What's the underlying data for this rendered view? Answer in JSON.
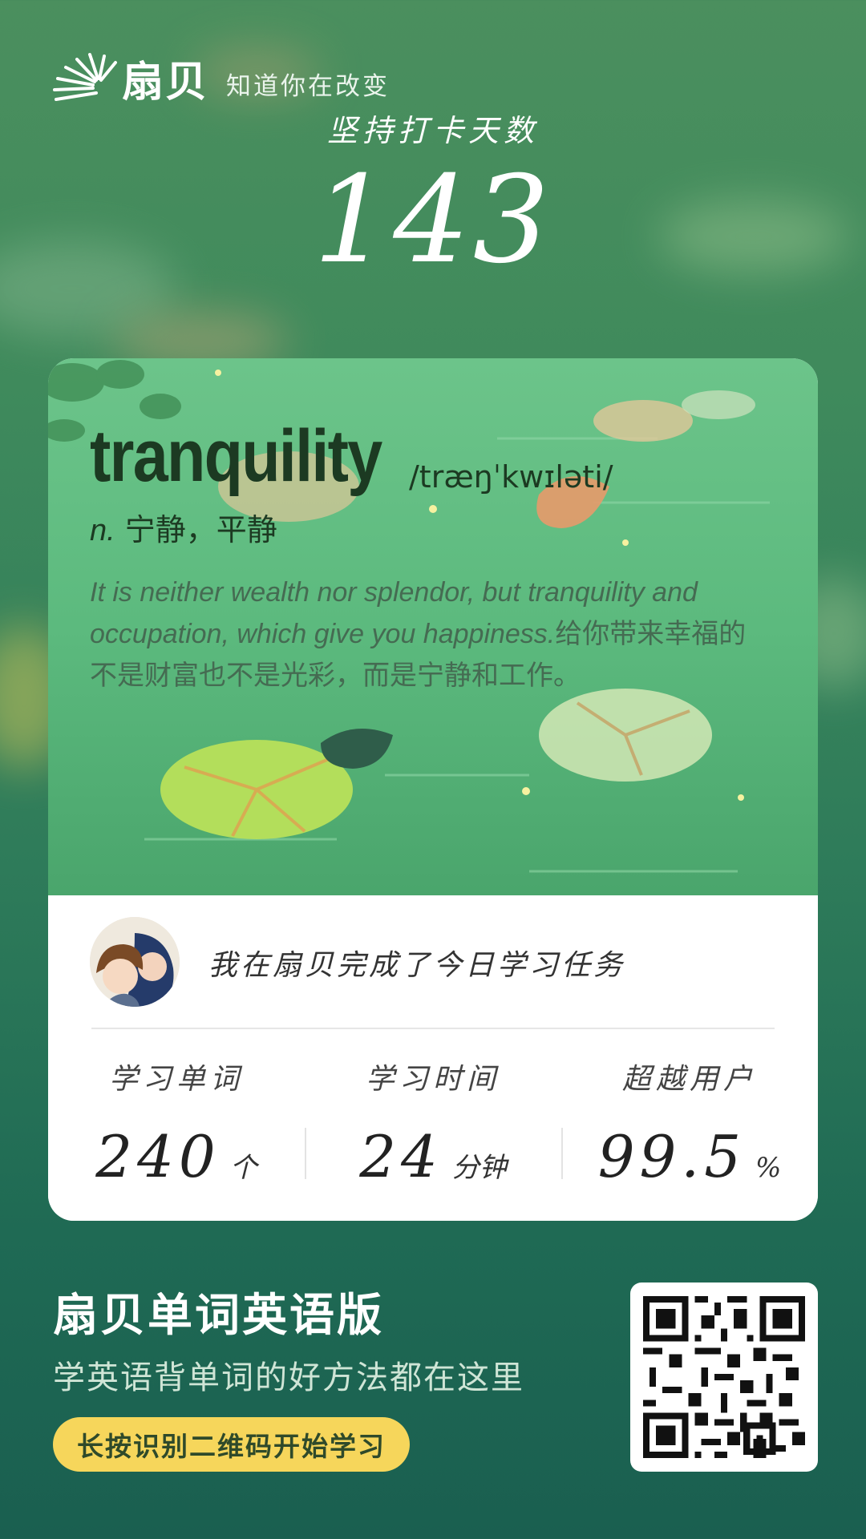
{
  "header": {
    "brand_name": "扇贝",
    "slogan": "知道你在改变",
    "streak_label": "坚持打卡天数",
    "streak_days": "143"
  },
  "word_card": {
    "word": "tranquility",
    "phonetic": "/træŋˈkwɪləti/",
    "part_of_speech": "n.",
    "definition": "宁静，平静",
    "example_en": "It is neither wealth nor splendor, but tranquility and occupation, which give you happiness.",
    "example_zh": "给你带来幸福的不是财富也不是光彩，而是宁静和工作。"
  },
  "summary": {
    "done_text": "我在扇贝完成了今日学习任务",
    "stats": [
      {
        "label": "学习单词",
        "value": "240",
        "unit": "个"
      },
      {
        "label": "学习时间",
        "value": "24",
        "unit": "分钟"
      },
      {
        "label": "超越用户",
        "value": "99.5",
        "unit": "%"
      }
    ]
  },
  "footer": {
    "app_title": "扇贝单词英语版",
    "app_subtitle": "学英语背单词的好方法都在这里",
    "cta_label": "长按识别二维码开始学习"
  },
  "icons": {
    "logo": "shanbay-shell-logo",
    "qr": "qr-code"
  },
  "colors": {
    "accent_yellow": "#f6d65b",
    "background_green": "#2f7c5a",
    "word_dark_green": "#1c3a22"
  }
}
